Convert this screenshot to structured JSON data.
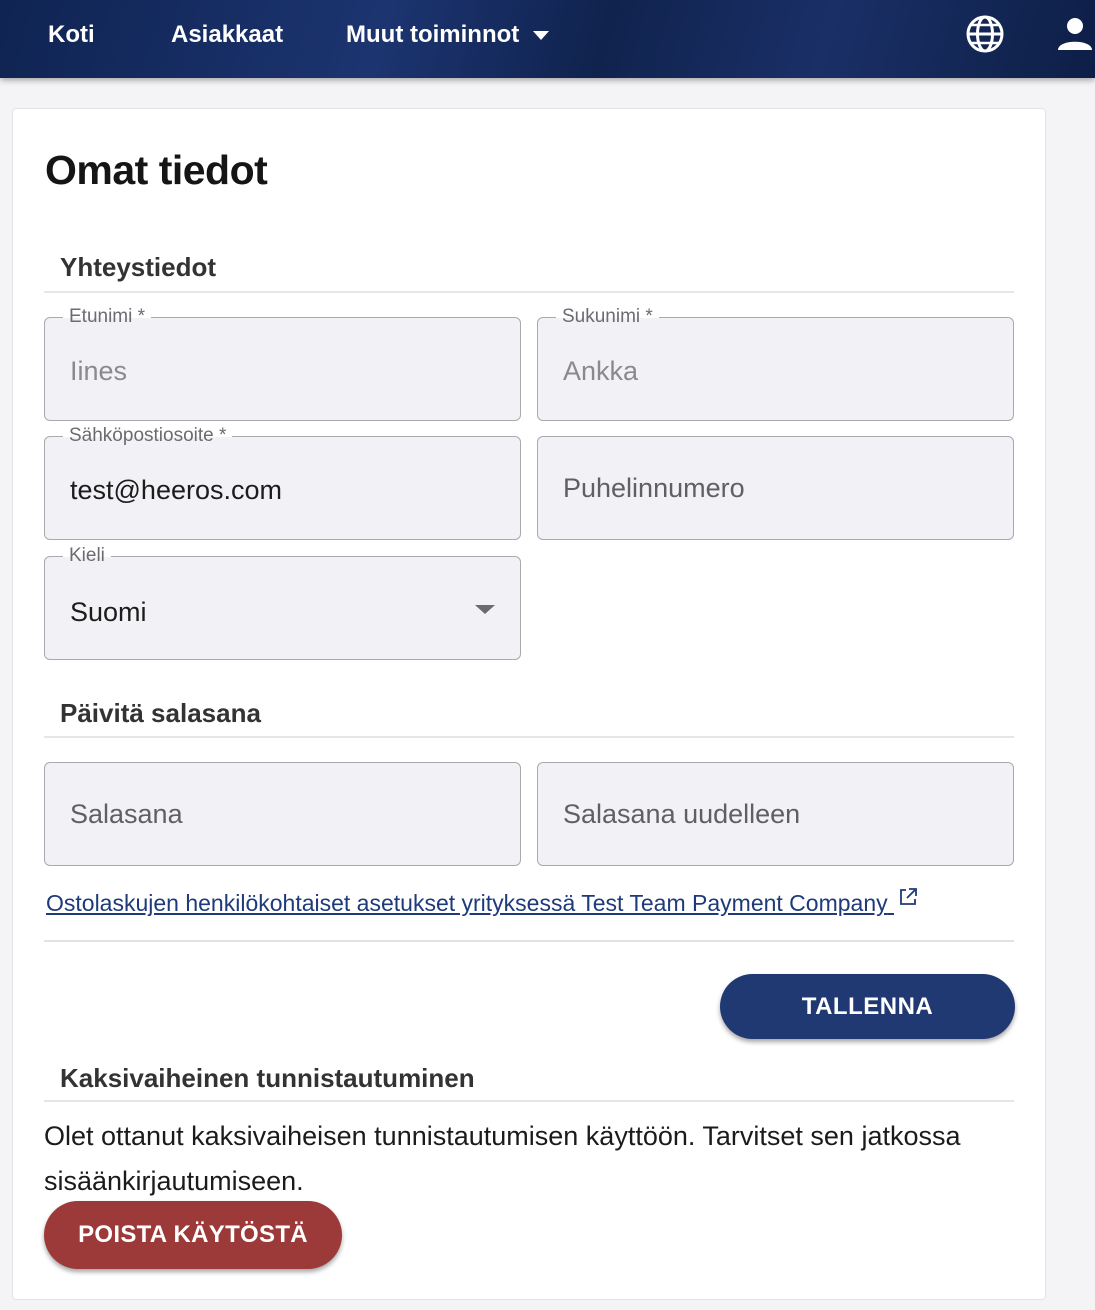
{
  "nav": {
    "items": [
      {
        "label": "Koti"
      },
      {
        "label": "Asiakkaat"
      },
      {
        "label": "Muut toiminnot"
      }
    ],
    "icons": {
      "language": "globe-icon",
      "account": "user-icon"
    },
    "colors": {
      "bar": "#1a2f66",
      "text": "#ffffff"
    }
  },
  "page": {
    "title": "Omat tiedot"
  },
  "contact": {
    "section_title": "Yhteystiedot",
    "first_name": {
      "label": "Etunimi *",
      "value": "Iines"
    },
    "last_name": {
      "label": "Sukunimi *",
      "value": "Ankka"
    },
    "email": {
      "label": "Sähköpostiosoite *",
      "value": "test@heeros.com"
    },
    "phone": {
      "placeholder": "Puhelinnumero"
    },
    "language": {
      "label": "Kieli",
      "value": "Suomi"
    }
  },
  "password": {
    "section_title": "Päivitä salasana",
    "new_placeholder": "Salasana",
    "repeat_placeholder": "Salasana uudelleen"
  },
  "invoice_link": {
    "label": "Ostolaskujen henkilökohtaiset asetukset yrityksessä Test Team Payment Company"
  },
  "actions": {
    "save_label": "TALLENNA",
    "save_color": "#203972"
  },
  "two_factor": {
    "section_title": "Kaksivaiheinen tunnistautuminen",
    "description": "Olet ottanut kaksivaiheisen tunnistautumisen käyttöön. Tarvitset sen jatkossa sisäänkirjautumiseen.",
    "disable_label": "POISTA KÄYTÖSTÄ",
    "disable_color": "#9b3a38"
  }
}
